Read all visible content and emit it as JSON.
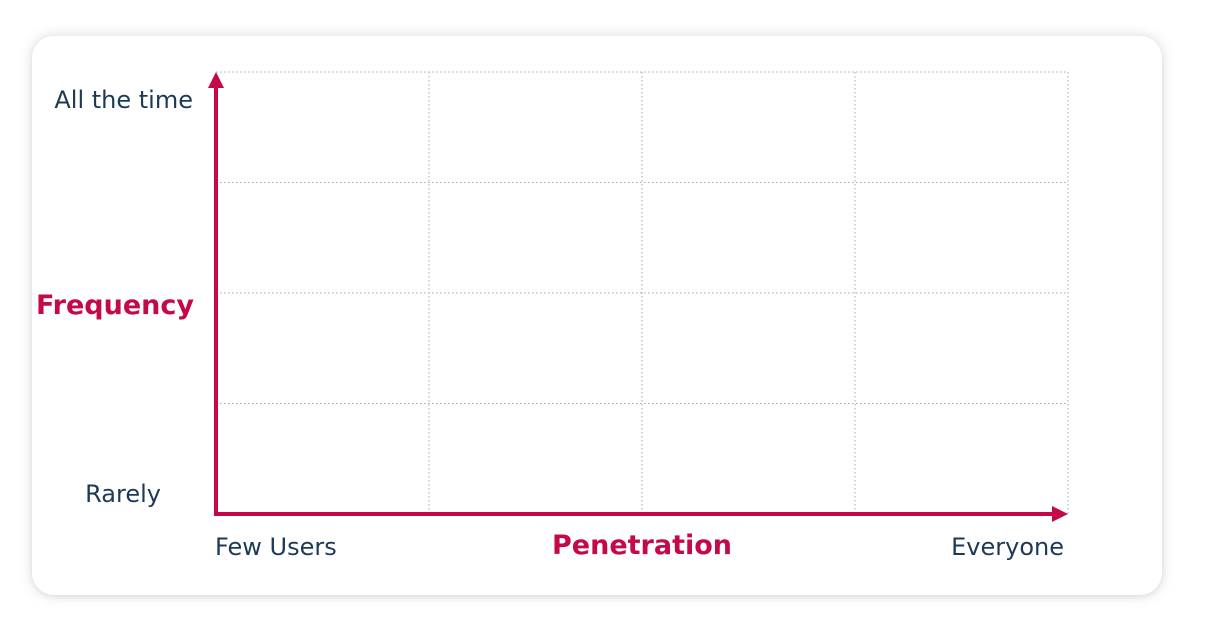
{
  "colors": {
    "accent": "#c4084a",
    "text": "#1c3a57",
    "grid": "#a8a8a8"
  },
  "diagram": {
    "type": "quadrant-matrix",
    "grid_rows": 4,
    "grid_cols": 4,
    "y_axis": {
      "title": "Frequency",
      "high_label": "All the time",
      "low_label": "Rarely"
    },
    "x_axis": {
      "title": "Penetration",
      "low_label": "Few Users",
      "high_label": "Everyone"
    }
  }
}
